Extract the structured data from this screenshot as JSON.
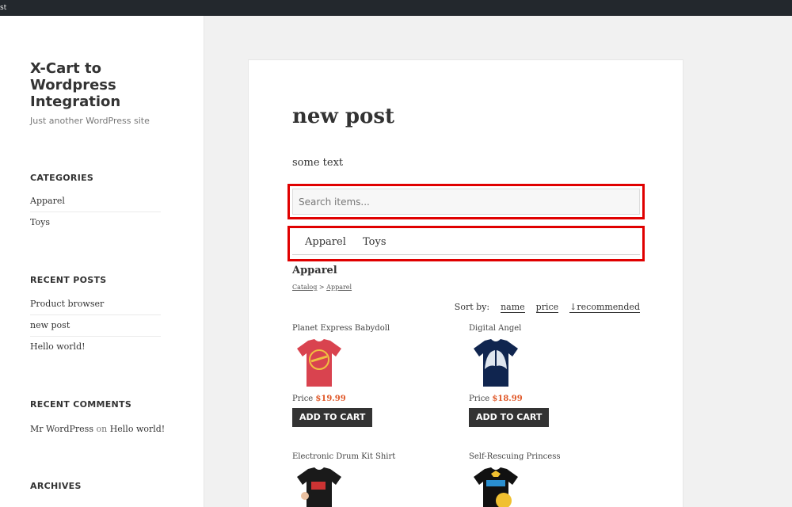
{
  "topbar": {
    "text": "st"
  },
  "site": {
    "title": "X-Cart to Wordpress Integration",
    "description": "Just another WordPress site"
  },
  "widgets": {
    "categories": {
      "title": "CATEGORIES",
      "items": [
        "Apparel",
        "Toys"
      ]
    },
    "recent_posts": {
      "title": "RECENT POSTS",
      "items": [
        "Product browser",
        "new post",
        "Hello world!"
      ]
    },
    "recent_comments": {
      "title": "RECENT COMMENTS",
      "author": "Mr WordPress",
      "on": "on",
      "post": "Hello world!"
    },
    "archives": {
      "title": "ARCHIVES"
    }
  },
  "post": {
    "title": "new post",
    "text": "some text"
  },
  "search": {
    "placeholder": "Search items..."
  },
  "tabs": [
    "Apparel",
    "Toys"
  ],
  "catalog": {
    "heading": "Apparel",
    "breadcrumb": {
      "root": "Catalog",
      "sep": " > ",
      "current": "Apparel"
    },
    "sort": {
      "label": "Sort by:",
      "options": [
        "name",
        "price",
        "↓recommended"
      ]
    },
    "price_label": "Price ",
    "add_to_cart": "ADD TO CART",
    "products": [
      {
        "name": "Planet Express Babydoll",
        "price": "$19.99",
        "shirt_color": "#d9434f"
      },
      {
        "name": "Digital Angel",
        "price": "$18.99",
        "shirt_color": "#10254f"
      },
      {
        "name": "Electronic Drum Kit Shirt",
        "price": "",
        "shirt_color": "#1a1a1a"
      },
      {
        "name": "Self-Rescuing Princess",
        "price": "",
        "shirt_color": "#111111"
      }
    ]
  },
  "colors": {
    "highlight": "#e00000",
    "price": "#e0592a",
    "button": "#333333"
  }
}
